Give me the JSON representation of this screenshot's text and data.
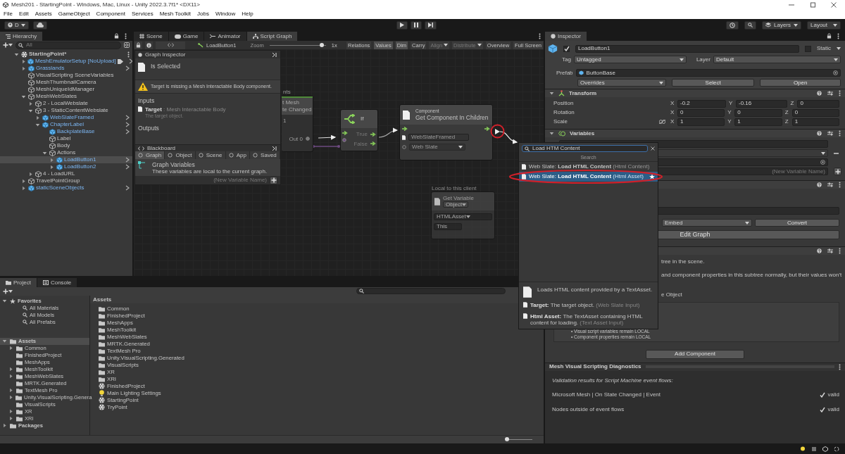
{
  "window": {
    "title": "Mesh201 - StartingPoint - Windows, Mac, Linux - Unity 2022.3.7f1* <DX11>"
  },
  "menu": [
    "File",
    "Edit",
    "Assets",
    "GameObject",
    "Component",
    "Services",
    "Mesh Toolkit",
    "Jobs",
    "Window",
    "Help"
  ],
  "toolbar": {
    "account": "D",
    "layers": "Layers",
    "layout": "Layout"
  },
  "hierarchy": {
    "title": "Hierarchy",
    "placeholder": "All",
    "items": [
      {
        "name": "StartingPoint*",
        "kind": "scene",
        "prefab": false,
        "selected": false,
        "expanded": true,
        "children": [
          {
            "name": "MeshEmulatorSetup [NoUpload]",
            "kind": "object",
            "prefab": true,
            "selected": false,
            "expanded": false,
            "tagged": true
          },
          {
            "name": "Grasslands",
            "kind": "object",
            "prefab": true,
            "selected": false,
            "expanded": false
          },
          {
            "name": "VisualScripting SceneVariables",
            "kind": "object",
            "prefab": false,
            "selected": false
          },
          {
            "name": "MeshThumbnailCamera",
            "kind": "object",
            "prefab": false,
            "selected": false
          },
          {
            "name": "MeshUniqueIdManager",
            "kind": "object",
            "prefab": false,
            "selected": false
          },
          {
            "name": "MeshWebSlates",
            "kind": "object",
            "prefab": false,
            "selected": false,
            "expanded": true,
            "children": [
              {
                "name": "2 - LocalWebslate",
                "kind": "object",
                "prefab": false,
                "selected": false,
                "expanded": false
              },
              {
                "name": "3 - StaticContentWebslate",
                "kind": "object",
                "prefab": false,
                "selected": false,
                "expanded": true,
                "children": [
                  {
                    "name": "WebSlateFramed",
                    "kind": "object",
                    "prefab": true,
                    "selected": false,
                    "expanded": false
                  },
                  {
                    "name": "ChapterLabel",
                    "kind": "object",
                    "prefab": true,
                    "selected": false,
                    "expanded": true,
                    "children": [
                      {
                        "name": "BackplateBase",
                        "kind": "object",
                        "prefab": true,
                        "selected": false
                      },
                      {
                        "name": "Label",
                        "kind": "object",
                        "prefab": false,
                        "selected": false
                      },
                      {
                        "name": "Body",
                        "kind": "object",
                        "prefab": false,
                        "selected": false
                      },
                      {
                        "name": "Actions",
                        "kind": "object",
                        "prefab": false,
                        "selected": false,
                        "expanded": true,
                        "children": [
                          {
                            "name": "LoadButton1",
                            "kind": "object",
                            "prefab": true,
                            "selected": true,
                            "expanded": false
                          },
                          {
                            "name": "LoadButton2",
                            "kind": "object",
                            "prefab": true,
                            "selected": false,
                            "expanded": false
                          }
                        ]
                      }
                    ]
                  }
                ]
              },
              {
                "name": "4 - LoadURL",
                "kind": "object",
                "prefab": false,
                "selected": false,
                "expanded": false
              }
            ]
          },
          {
            "name": "TravelPointGroup",
            "kind": "object",
            "prefab": false,
            "selected": false,
            "expanded": false
          },
          {
            "name": "staticSceneObjects",
            "kind": "object",
            "prefab": true,
            "selected": false,
            "expanded": false
          }
        ]
      }
    ]
  },
  "graph_view": {
    "tabs": [
      {
        "label": "Scene",
        "selected": false
      },
      {
        "label": "Game",
        "selected": false
      },
      {
        "label": "Animator",
        "selected": false
      },
      {
        "label": "Script Graph",
        "selected": true
      }
    ],
    "breadcrumb": "LoadButton1",
    "zoom_label": "Zoom",
    "zoom": {
      "level": 0.93
    },
    "zoom_reading": "1x",
    "tools": [
      {
        "label": "Relations",
        "selected": false,
        "disabled": false,
        "dropdown": false
      },
      {
        "label": "Values",
        "selected": true,
        "disabled": false,
        "dropdown": false
      },
      {
        "label": "Dim",
        "selected": true,
        "disabled": false,
        "dropdown": false
      },
      {
        "label": "Carry",
        "selected": false,
        "disabled": false,
        "dropdown": false
      },
      {
        "label": "Align",
        "selected": false,
        "disabled": true,
        "dropdown": true
      },
      {
        "label": "Distribute",
        "selected": false,
        "disabled": true,
        "dropdown": true
      },
      {
        "label": "Overview",
        "selected": false,
        "disabled": false,
        "dropdown": false
      },
      {
        "label": "Full Screen",
        "selected": false,
        "disabled": false,
        "dropdown": false
      }
    ],
    "graph_inspector": {
      "title": "Graph Inspector",
      "node_title": "Is Selected",
      "warning": "Target is missing a Mesh Interactable Body component.",
      "inputs_heading": "Inputs",
      "input_name": "Target",
      "input_type": ": Mesh Interactable Body",
      "input_description": "The target object.",
      "outputs_heading": "Outputs"
    },
    "blackboard": {
      "title": "Blackboard",
      "tabs": [
        {
          "label": "Graph",
          "selected": true
        },
        {
          "label": "Object",
          "selected": false
        },
        {
          "label": "Scene",
          "selected": false
        },
        {
          "label": "App",
          "selected": false
        },
        {
          "label": "Saved",
          "selected": false
        }
      ],
      "heading": "Graph Variables",
      "description": "These variables are local to the current graph.",
      "placeholder": "(New Variable Name)"
    },
    "nodes": [
      {
        "kind": "event",
        "group": "nts",
        "category": "t Mesh",
        "title": "te Changed",
        "value": "1",
        "output": "Out 0"
      },
      {
        "kind": "if",
        "title": "If",
        "outputs": [
          "True",
          "False"
        ]
      },
      {
        "kind": "component",
        "category": "Component",
        "title": "Get Component In Children",
        "target": "WebSlateFramed",
        "type": "Web Slate"
      },
      {
        "kind": "variable",
        "group": "Local to this client",
        "title": "Get Variable",
        "scope": "Object",
        "name": "HTMLAsset",
        "target": "This"
      }
    ]
  },
  "search_popup": {
    "query": "Load HTM Content",
    "heading": "Search",
    "results": [
      {
        "prefix": "Web Slate: ",
        "name": "Load HTML Content",
        "detail": "(Html Content)",
        "selected": false,
        "favorite": false
      },
      {
        "prefix": "Web Slate: ",
        "name": "Load HTML Content",
        "detail": "(Html Asset)",
        "selected": true,
        "favorite": true
      }
    ],
    "description": "Loads HTML content provided by a TextAsset.",
    "ports": [
      {
        "name": "Target:",
        "text": "The target object.",
        "type": "(Web Slate Input)"
      },
      {
        "name": "Html Asset:",
        "text": "The TextAsset containing HTML content for loading.",
        "type": "(Text Asset Input)"
      }
    ]
  },
  "inspector": {
    "title": "Inspector",
    "object_name": "LoadButton1",
    "active": true,
    "static_label": "Static",
    "static": false,
    "tag_label": "Tag",
    "tag": "Untagged",
    "layer_label": "Layer",
    "layer": "Default",
    "prefab_label": "Prefab",
    "prefab": "ButtonBase",
    "overrides": "Overrides",
    "select": "Select",
    "open": "Open",
    "transform": {
      "title": "Transform",
      "rows": [
        {
          "label": "Position",
          "values": [
            {
              "axis": "X",
              "value": "-0.2"
            },
            {
              "axis": "Y",
              "value": "-0.16"
            },
            {
              "axis": "Z",
              "value": "0"
            }
          ]
        },
        {
          "label": "Rotation",
          "values": [
            {
              "axis": "X",
              "value": "0"
            },
            {
              "axis": "Y",
              "value": "0"
            },
            {
              "axis": "Z",
              "value": "0"
            }
          ]
        },
        {
          "label": "Scale",
          "linked": false,
          "values": [
            {
              "axis": "X",
              "value": "1"
            },
            {
              "axis": "Y",
              "value": "1"
            },
            {
              "axis": "Z",
              "value": "1"
            }
          ]
        }
      ]
    },
    "variables": {
      "title": "Variables",
      "placeholder": "(New Variable Name)"
    },
    "script_machine": {
      "source": "Embed",
      "convert": "Convert",
      "edit": "Edit Graph"
    },
    "notes": [
      "tree in the scene.",
      "and component properties in this subtree normally, but their values won't",
      "e Object"
    ],
    "bullets": [
      "• Visual script variables remain LOCAL",
      "• Component properties remain LOCAL"
    ],
    "add_component": "Add Component",
    "diagnostics": {
      "title": "Mesh Visual Scripting Diagnostics",
      "intro": "Validation results for Script Machine event flows:",
      "results": [
        {
          "label": "Microsoft Mesh | On State Changed | Event",
          "status": "valid",
          "valid": true
        },
        {
          "label": "Nodes outside of event flows",
          "status": "valid",
          "valid": true
        }
      ]
    }
  },
  "project": {
    "tabs": [
      {
        "label": "Project",
        "selected": true
      },
      {
        "label": "Console",
        "selected": false
      }
    ],
    "favorites": {
      "label": "Favorites",
      "expanded": true,
      "items": [
        "All Materials",
        "All Models",
        "All Prefabs"
      ]
    },
    "tree": [
      {
        "name": "Assets",
        "expanded": true,
        "selected": true,
        "children": [
          {
            "name": "Common",
            "expanded": false,
            "selected": false
          },
          {
            "name": "FinishedProject",
            "selected": false
          },
          {
            "name": "MeshApps",
            "selected": false
          },
          {
            "name": "MeshToolkit",
            "expanded": false,
            "selected": false
          },
          {
            "name": "MeshWebSlates",
            "expanded": false,
            "selected": false
          },
          {
            "name": "MRTK.Generated",
            "selected": false
          },
          {
            "name": "TextMesh Pro",
            "expanded": false,
            "selected": false
          },
          {
            "name": "Unity.VisualScripting.Genera",
            "expanded": false,
            "selected": false
          },
          {
            "name": "VisualScripts",
            "selected": false
          },
          {
            "name": "XR",
            "expanded": false,
            "selected": false
          },
          {
            "name": "XRI",
            "expanded": false,
            "selected": false
          }
        ]
      },
      {
        "name": "Packages",
        "expanded": false,
        "selected": false
      }
    ],
    "breadcrumb": "Assets",
    "assets": [
      {
        "name": "Common",
        "kind": "folder"
      },
      {
        "name": "FinishedProject",
        "kind": "folder"
      },
      {
        "name": "MeshApps",
        "kind": "folder"
      },
      {
        "name": "MeshToolkit",
        "kind": "folder"
      },
      {
        "name": "MeshWebSlates",
        "kind": "folder"
      },
      {
        "name": "MRTK.Generated",
        "kind": "folder"
      },
      {
        "name": "TextMesh Pro",
        "kind": "folder"
      },
      {
        "name": "Unity.VisualScripting.Generated",
        "kind": "folder"
      },
      {
        "name": "VisualScripts",
        "kind": "folder"
      },
      {
        "name": "XR",
        "kind": "folder"
      },
      {
        "name": "XRI",
        "kind": "folder"
      },
      {
        "name": "FinishedProject",
        "kind": "scene"
      },
      {
        "name": "Main Lighting Settings",
        "kind": "lighting"
      },
      {
        "name": "StartingPoint",
        "kind": "scene"
      },
      {
        "name": "TryPoint",
        "kind": "scene"
      }
    ],
    "icon_size": {
      "level": 0.05
    }
  }
}
